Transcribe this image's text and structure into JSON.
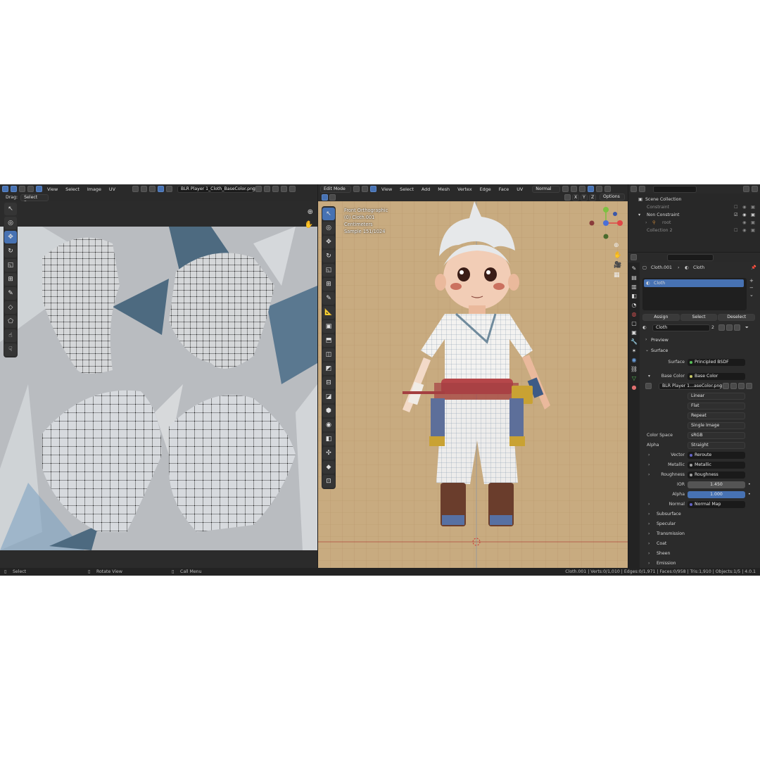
{
  "uv_editor": {
    "menus": [
      "View",
      "Select",
      "Image",
      "UV"
    ],
    "image_name": "BLR Player 1_Cloth_BaseColor.png",
    "drag_label": "Drag:",
    "drag_value": "Select Box"
  },
  "viewport": {
    "mode": "Edit Mode",
    "menus": [
      "View",
      "Select",
      "Add",
      "Mesh",
      "Vertex",
      "Edge",
      "Face",
      "UV"
    ],
    "orientation": "Normal",
    "axes": [
      "X",
      "Y",
      "Z"
    ],
    "options": "Options",
    "view_name": "Front Orthographic",
    "object_line": "(0) Cloth.001",
    "units": "Centimeters",
    "sample": "Sample 151/1024"
  },
  "outliner": {
    "items": [
      {
        "label": "Scene Collection"
      },
      {
        "label": "Constraint"
      },
      {
        "label": "Non Constraint"
      },
      {
        "label": "root"
      },
      {
        "label": "Collection 2"
      }
    ]
  },
  "properties": {
    "breadcrumb_object": "Cloth.001",
    "breadcrumb_material": "Cloth",
    "slot": "Cloth",
    "buttons": [
      "Assign",
      "Select",
      "Deselect"
    ],
    "material_name": "Cloth",
    "user_count": "2",
    "preview": "Preview",
    "surface_section": "Surface",
    "surface_label": "Surface",
    "surface_value": "Principled BSDF",
    "base_color_label": "Base Color",
    "base_color_value": "Base Color",
    "image_field": "BLR Player 1...aseColor.png",
    "interp": "Linear",
    "projection": "Flat",
    "extension": "Repeat",
    "source": "Single Image",
    "color_space_label": "Color Space",
    "color_space": "sRGB",
    "alpha_label": "Alpha",
    "alpha_mode": "Straight",
    "vector_label": "Vector",
    "vector_value": "Reroute",
    "metallic_label": "Metallic",
    "metallic_value": "Metallic",
    "roughness_label": "Roughness",
    "roughness_value": "Roughness",
    "ior_label": "IOR",
    "ior_value": "1.450",
    "alpha2_label": "Alpha",
    "alpha2_value": "1.000",
    "normal_label": "Normal",
    "normal_value": "Normal Map",
    "subsections": [
      "Subsurface",
      "Specular",
      "Transmission",
      "Coat",
      "Sheen",
      "Emission"
    ]
  },
  "status": {
    "left": [
      "Select",
      "Rotate View",
      "Call Menu"
    ],
    "right": "Cloth.001 | Verts:0/1,010 | Edges:0/1,971 | Faces:0/958 | Tris:1,910 | Objects:1/5 | 4.0.1"
  },
  "colors": {
    "accent": "#4772b3",
    "background": "#c6a97f"
  }
}
